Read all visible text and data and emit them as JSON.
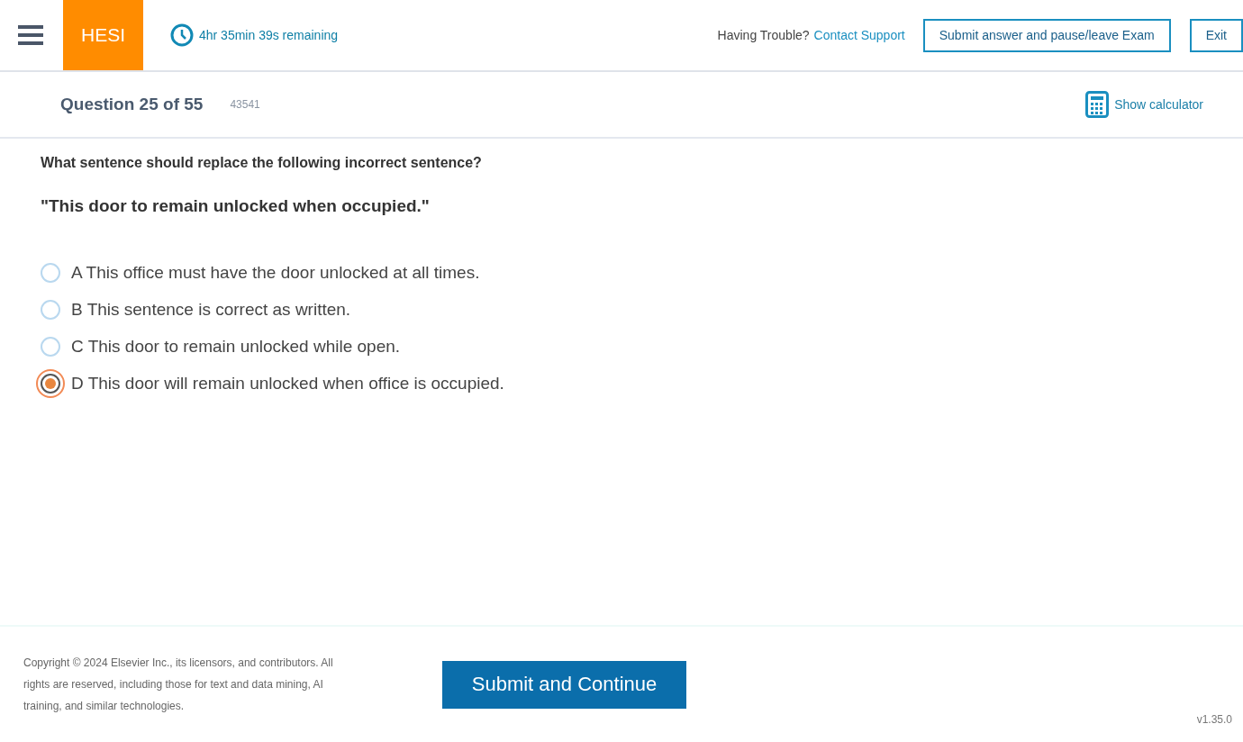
{
  "header": {
    "logo": "HESI",
    "timer": "4hr 35min 39s remaining",
    "help_text": "Having Trouble?",
    "help_link": "Contact Support",
    "pause_button": "Submit answer and pause/leave Exam",
    "exit_button": "Exit"
  },
  "question_bar": {
    "title": "Question 25 of 55",
    "id": "43541",
    "calculator": "Show calculator"
  },
  "question": {
    "prompt": "What sentence should replace the following incorrect sentence?",
    "quote": "\"This door to remain unlocked when occupied.\""
  },
  "options": [
    {
      "letter": "A",
      "text": "This office must have the door unlocked at all times.",
      "selected": false
    },
    {
      "letter": "B",
      "text": "This sentence is correct as written.",
      "selected": false
    },
    {
      "letter": "C",
      "text": "This door to remain unlocked while open.",
      "selected": false
    },
    {
      "letter": "D",
      "text": "This door will remain unlocked when office is occupied.",
      "selected": true
    }
  ],
  "footer": {
    "copyright": "Copyright © 2024 Elsevier Inc., its licensors, and contributors. All rights are reserved, including those for text and data mining, AI training, and similar technologies.",
    "submit_button": "Submit and Continue",
    "version": "v1.35.0"
  }
}
